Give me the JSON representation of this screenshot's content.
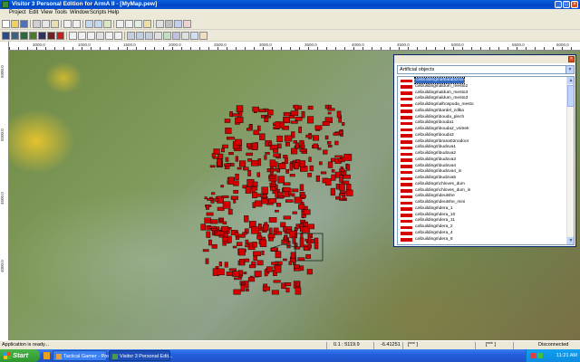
{
  "window": {
    "title": "Visitor 3 Personal Edition for ArmA II - [MyMap.pew]",
    "controls": [
      "_",
      "□",
      "×"
    ]
  },
  "menu": [
    "Project",
    "Edit",
    "View",
    "Tools",
    "Window",
    "Scripts",
    "Help"
  ],
  "ruler": {
    "top": [
      "3000.0",
      "1000.0",
      "1500.0",
      "2000.0",
      "2500.0",
      "3000.0",
      "3500.0",
      "4000.0",
      "4500.0",
      "5000.0",
      "5500.0",
      "6000.0"
    ],
    "left": [
      "5000.0",
      "5500.0",
      "4500.0",
      "4000.0"
    ]
  },
  "objects_panel": {
    "close_label": "×",
    "selected_category": "Artificial objects",
    "items": [
      "ca\\buildings\\afbarabizna",
      "ca\\buildings\\aldum_mesto2",
      "ca\\buildings\\aldum_mesto3",
      "ca\\buildings\\aldum_mesto3",
      "ca\\buildings\\alhospoda_mesto",
      "ca\\buildings\\bardel_zdlka",
      "ca\\buildings\\bouda_plech",
      "ca\\buildings\\bouda1",
      "ca\\buildings\\bouda2_vnitrek",
      "ca\\buildings\\bouda3",
      "ca\\buildings\\brana02nodoor",
      "ca\\buildings\\budova1",
      "ca\\buildings\\budova2",
      "ca\\buildings\\budova3",
      "ca\\buildings\\budova4",
      "ca\\buildings\\budova4_in",
      "ca\\buildings\\budova5",
      "ca\\buildings\\chloves_dum",
      "ca\\buildings\\chloves_dum_in",
      "ca\\buildings\\deutshe",
      "ca\\buildings\\deutshe_mini",
      "ca\\buildings\\dera_1",
      "ca\\buildings\\dera_10",
      "ca\\buildings\\dera_11",
      "ca\\buildings\\dera_2",
      "ca\\buildings\\dera_4",
      "ca\\buildings\\dera_6"
    ]
  },
  "status": {
    "left": "Application is ready...",
    "coords1": "0.1 : 5119.9",
    "coords2": "-6.41251",
    "mode1": "[*** ]",
    "mode2": "[*** ]",
    "connection": "Disconnected"
  },
  "taskbar": {
    "start": "Start",
    "tasks": [
      "Tactical Gamer - Post ...",
      "Visitor 3 Personal Edit..."
    ],
    "clock": "11:21 AM"
  },
  "colors": {
    "building_fill": "#d40000",
    "accent": "#0a5fd8",
    "selection": "#316ac5"
  }
}
